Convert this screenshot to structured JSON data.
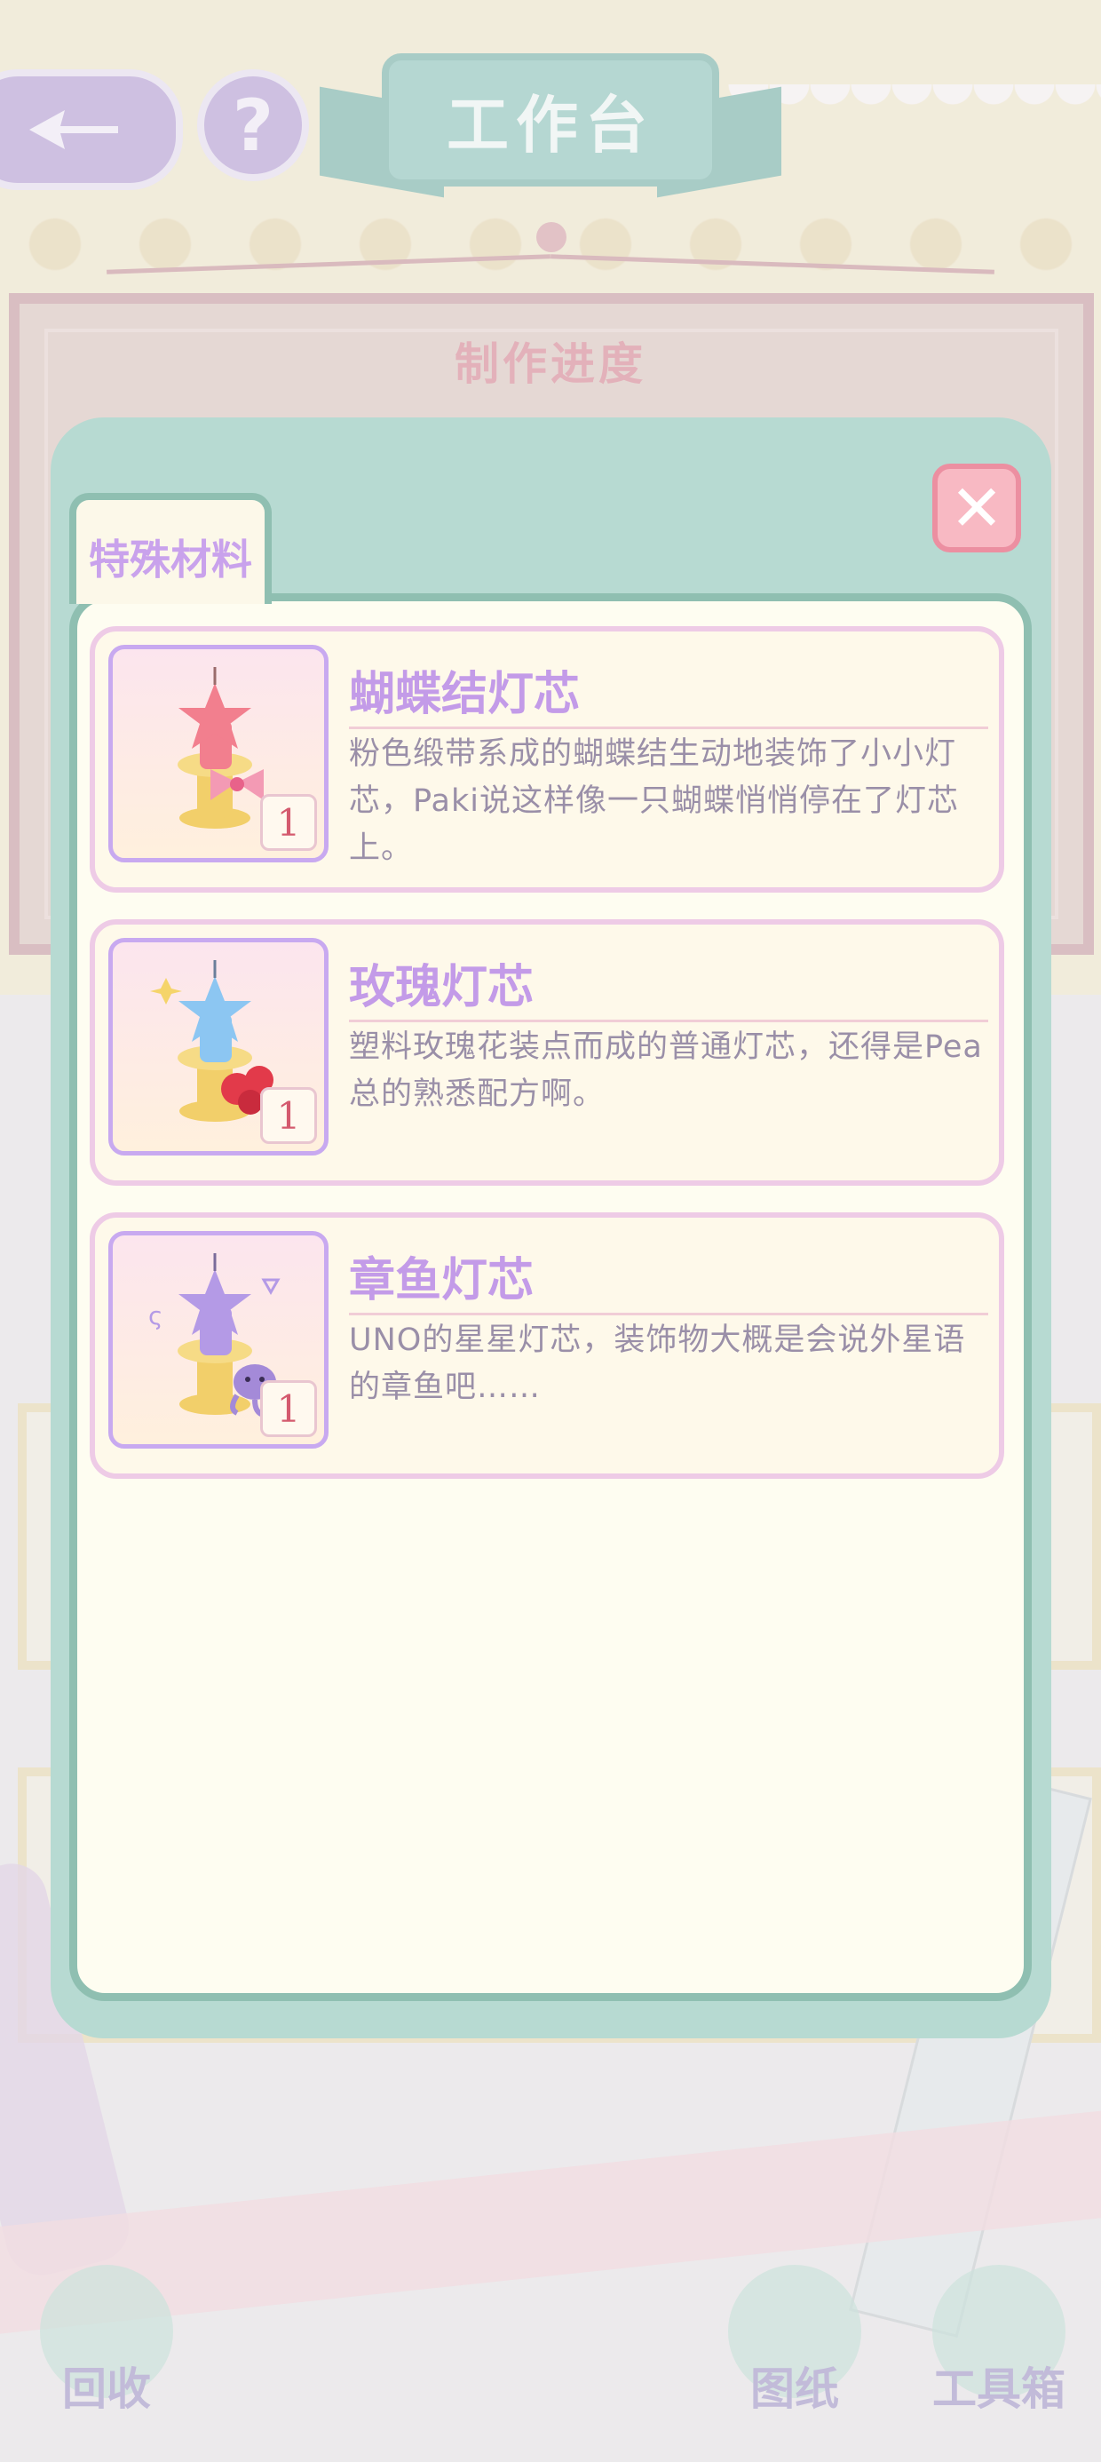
{
  "header": {
    "title": "工作台",
    "help_label": "?"
  },
  "background": {
    "board_title": "制作进度"
  },
  "modal": {
    "tab_label": "特殊材料",
    "close_label": "✕",
    "items": [
      {
        "name": "蝴蝶结灯芯",
        "description": "粉色缎带系成的蝴蝶结生动地装饰了小小灯芯，Paki说这样像一只蝴蝶悄悄停在了灯芯上。",
        "count": "1",
        "candle_color": "#f27f8e",
        "icon": "bow-candle-icon"
      },
      {
        "name": "玫瑰灯芯",
        "description": "塑料玫瑰花装点而成的普通灯芯，还得是Pea总的熟悉配方啊。",
        "count": "1",
        "candle_color": "#8cc6f2",
        "icon": "rose-candle-icon"
      },
      {
        "name": "章鱼灯芯",
        "description": "UNO的星星灯芯，装饰物大概是会说外星语的章鱼吧……",
        "count": "1",
        "candle_color": "#b49ae6",
        "icon": "octopus-candle-icon"
      }
    ]
  },
  "bottom_bar": {
    "recycle_label": "回收",
    "blueprint_label": "图纸",
    "toolbox_label": "工具箱"
  },
  "colors": {
    "accent_teal": "#b7dad2",
    "panel_border": "#8fbfb1",
    "title_purple": "#c39be8",
    "close_pink": "#f8b9c3"
  }
}
